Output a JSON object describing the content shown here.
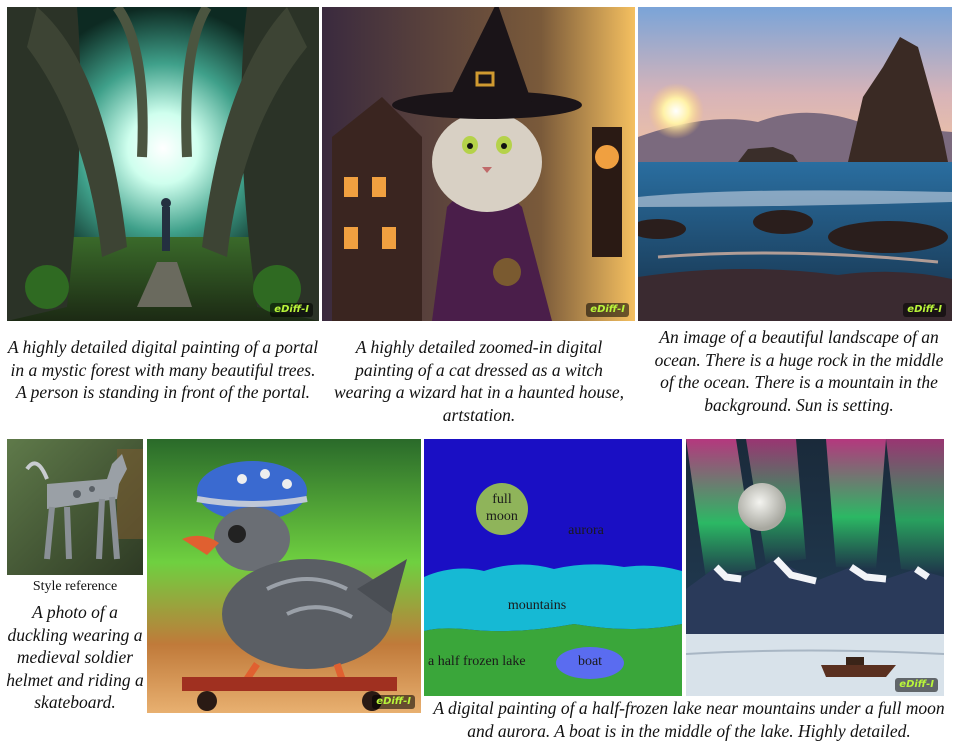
{
  "badge": "eDiff-I",
  "row1": {
    "captions": [
      "A highly detailed digital painting of a portal in a mystic forest with many beautiful trees. A person is standing in front of the portal.",
      "A highly detailed zoomed-in digital painting of a cat dressed as a witch wearing a wizard hat in a haunted house, artstation.",
      "An image of a beautiful landscape of an ocean. There is a huge rock in the middle of the ocean. There is a mountain in the background. Sun is setting."
    ]
  },
  "row2": {
    "style_reference_label": "Style reference",
    "duck_caption": "A photo of a duckling wearing a medieval soldier helmet and riding a skateboard.",
    "segmentation_labels": {
      "moon": "full moon",
      "aurora": "aurora",
      "mountains": "mountains",
      "lake": "a half frozen lake",
      "boat": "boat"
    },
    "lake_caption": "A digital painting of a half-frozen lake near mountains under a full moon and aurora. A boat is in the middle of the lake. Highly detailed."
  },
  "colors": {
    "badge_text": "#b9f53a",
    "seg_sky": "#1a0fc4",
    "seg_mountains": "#16b9d4",
    "seg_lake": "#3aa63a",
    "seg_moon": "#8fb45a",
    "seg_boat": "#5a6cf0"
  }
}
